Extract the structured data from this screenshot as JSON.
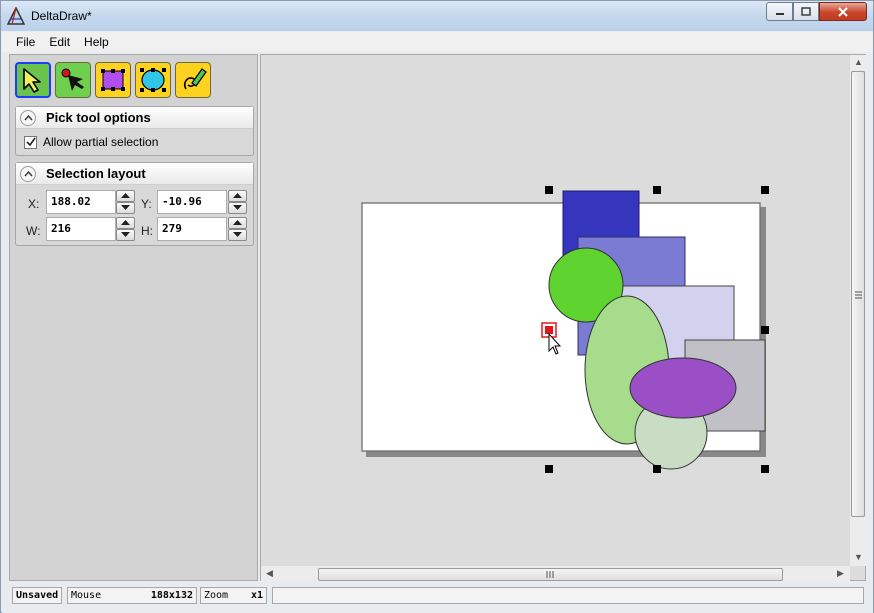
{
  "app": {
    "title": "DeltaDraw*"
  },
  "menu": {
    "file": "File",
    "edit": "Edit",
    "help": "Help"
  },
  "tools": [
    "pick",
    "node",
    "rectangle",
    "ellipse",
    "pen"
  ],
  "pick_group": {
    "title": "Pick tool options",
    "allow_partial": "Allow partial selection",
    "allow_partial_checked": true
  },
  "layout_group": {
    "title": "Selection layout",
    "x_label": "X:",
    "x_value": "188.02",
    "y_label": "Y:",
    "y_value": "-10.96",
    "w_label": "W:",
    "w_value": "216",
    "h_label": "H:",
    "h_value": "279"
  },
  "status": {
    "saved": "Unsaved",
    "mouse_label": "Mouse",
    "mouse_value": "188x132",
    "zoom_label": "Zoom",
    "zoom_value": "x1"
  },
  "colors": {
    "dark_blue_rect": "#3535bd",
    "mid_blue_rect": "#7b7bd3",
    "lavender_rect": "#d2d2ee",
    "gray_rect": "#c0c0c6",
    "green_circle": "#5fd32f",
    "light_green_ellipse": "#a6dc8c",
    "purple_ellipse": "#9a4fc6",
    "sage_circle": "#c9dcc4",
    "handle_red": "#e01818"
  }
}
